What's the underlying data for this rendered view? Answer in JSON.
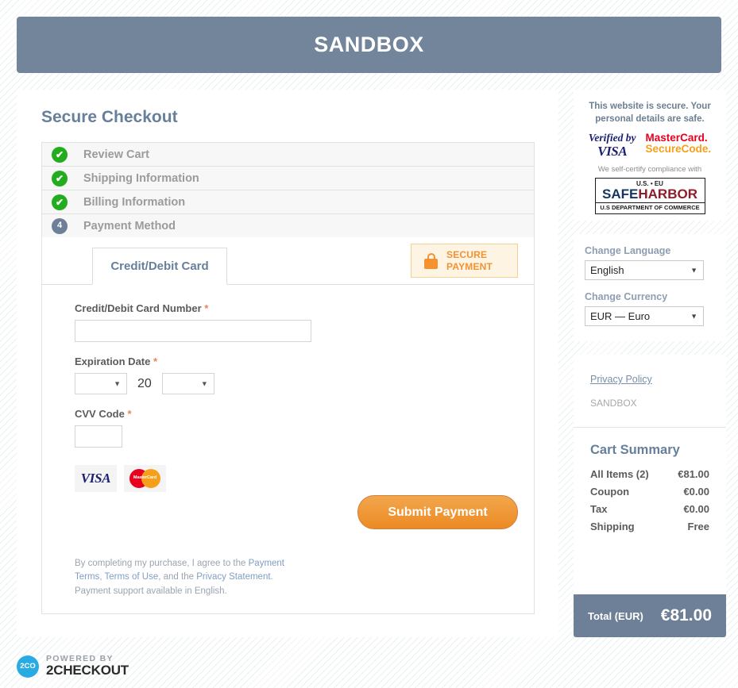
{
  "header": {
    "title": "SANDBOX"
  },
  "page": {
    "heading": "Secure Checkout"
  },
  "steps": [
    {
      "label": "Review Cart",
      "state": "done",
      "mark": "✔"
    },
    {
      "label": "Shipping Information",
      "state": "done",
      "mark": "✔"
    },
    {
      "label": "Billing Information",
      "state": "done",
      "mark": "✔"
    },
    {
      "label": "Payment Method",
      "state": "current",
      "mark": "4"
    }
  ],
  "payment": {
    "tab_label": "Credit/Debit Card",
    "secure_badge": {
      "line1": "SECURE",
      "line2": "PAYMENT",
      "icon": "lock-icon"
    },
    "card_number": {
      "label": "Credit/Debit Card Number",
      "required": "*",
      "value": "",
      "placeholder": ""
    },
    "expiration": {
      "label": "Expiration Date",
      "required": "*",
      "month_value": "",
      "century": "20",
      "year_value": ""
    },
    "cvv": {
      "label": "CVV Code",
      "required": "*",
      "value": "",
      "placeholder": ""
    },
    "accepted_cards": [
      {
        "name": "visa-logo",
        "text": "VISA"
      },
      {
        "name": "mastercard-logo",
        "text": "MasterCard"
      }
    ],
    "submit_label": "Submit Payment"
  },
  "legal": {
    "text_1": "By completing my purchase, I agree to the ",
    "link_payment_terms": "Payment Terms",
    "text_2": ", ",
    "link_terms_of_use": "Terms of Use",
    "text_3": ", and the ",
    "link_privacy_statement": "Privacy Statement",
    "text_4": ".",
    "support_line": "Payment support available in English."
  },
  "sidebar": {
    "trust": {
      "message": "This website is secure. Your personal details are safe.",
      "verified_by_visa": {
        "line1": "Verified by",
        "line2": "VISA"
      },
      "mastercard_securecode": {
        "line1": "MasterCard.",
        "line2": "SecureCode."
      },
      "self_certify": "We self-certify compliance with",
      "safeharbor": {
        "top": "U.S. • EU",
        "mid_a": "SAFE",
        "mid_b": "HARBOR",
        "bottom": "U.S DEPARTMENT OF COMMERCE"
      }
    },
    "locale": {
      "language_label": "Change Language",
      "language_value": "English",
      "currency_label": "Change Currency",
      "currency_value": "EUR — Euro"
    },
    "policy": {
      "privacy_policy": "Privacy Policy",
      "merchant": "SANDBOX"
    },
    "cart": {
      "title": "Cart Summary",
      "rows": [
        {
          "label": "All Items (2)",
          "value": "€81.00"
        },
        {
          "label": "Coupon",
          "value": "€0.00"
        },
        {
          "label": "Tax",
          "value": "€0.00"
        },
        {
          "label": "Shipping",
          "value": "Free"
        }
      ],
      "total_label": "Total (EUR)",
      "total_value": "€81.00"
    }
  },
  "footer": {
    "logo_mark": "2CO",
    "powered_by": "POWERED BY",
    "brand": "2CHECKOUT"
  },
  "colors": {
    "header_bg": "#72859a",
    "accent_orange": "#ec8a24",
    "step_done": "#24ac1f",
    "step_current": "#6d8097",
    "heading_blue": "#667f9b",
    "total_bar": "#6d8097"
  }
}
